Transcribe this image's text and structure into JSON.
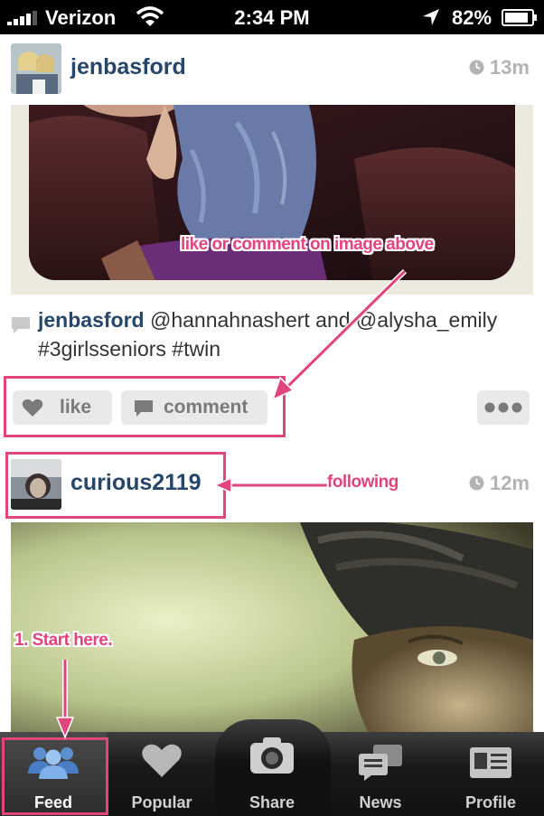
{
  "status_bar": {
    "carrier": "Verizon",
    "time": "2:34 PM",
    "battery": "82%"
  },
  "posts": [
    {
      "username": "jenbasford",
      "time": "13m",
      "caption_user": "jenbasford",
      "caption_text": " @hannahnashert and @alysha_emily #3girlsseniors #twin",
      "like_label": "like",
      "comment_label": "comment"
    },
    {
      "username": "curious2119",
      "time": "12m"
    }
  ],
  "annotations": {
    "like_comment": "like or comment on image above",
    "following": "following",
    "start": "1. Start here."
  },
  "tabs": [
    {
      "label": "Feed",
      "icon": "people-icon",
      "active": true
    },
    {
      "label": "Popular",
      "icon": "heart-icon"
    },
    {
      "label": "Share",
      "icon": "camera-icon"
    },
    {
      "label": "News",
      "icon": "chat-bubbles-icon"
    },
    {
      "label": "Profile",
      "icon": "id-card-icon"
    }
  ],
  "colors": {
    "annotation": "#e0457b",
    "username": "#26466a",
    "tab_bar": "#1a1a1a"
  }
}
